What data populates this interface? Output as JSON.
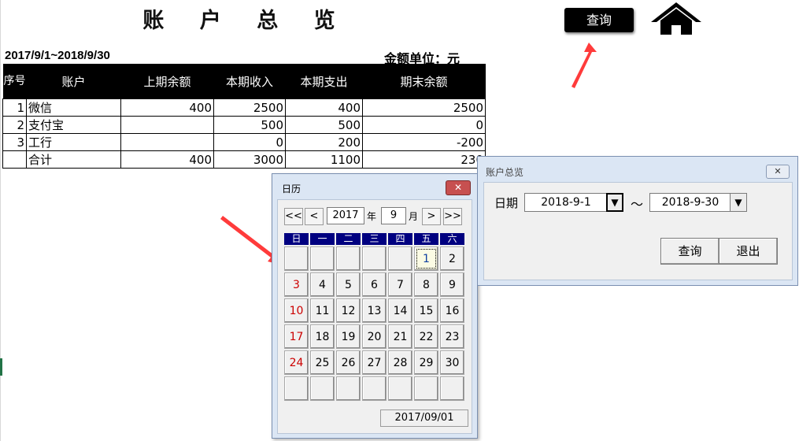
{
  "sheet": {
    "title": "账 户 总 览",
    "period": "2017/9/1~2018/9/30",
    "unit": "金额单位：元",
    "query_button": "查询",
    "home_icon": "home-icon"
  },
  "table": {
    "headers": [
      "序号",
      "账户",
      "上期余额",
      "本期收入",
      "本期支出",
      "期末余额"
    ],
    "rows": [
      {
        "seq": "1",
        "account": "微信",
        "prev": "400",
        "income": "2500",
        "expense": "400",
        "end": "2500"
      },
      {
        "seq": "2",
        "account": "支付宝",
        "prev": "",
        "income": "500",
        "expense": "500",
        "end": "0"
      },
      {
        "seq": "3",
        "account": "工行",
        "prev": "",
        "income": "0",
        "expense": "200",
        "end": "-200"
      },
      {
        "seq": "",
        "account": "合计",
        "prev": "400",
        "income": "3000",
        "expense": "1100",
        "end": "230"
      }
    ]
  },
  "calendar": {
    "caption": "日历",
    "close": "✕",
    "nav": {
      "prev_year": "<<",
      "prev_month": "<",
      "next_month": ">",
      "next_year": ">>"
    },
    "year": "2017",
    "year_label": "年",
    "month": "9",
    "month_label": "月",
    "weekdays": [
      "日",
      "一",
      "二",
      "三",
      "四",
      "五",
      "六"
    ],
    "days": [
      "",
      "",
      "",
      "",
      "",
      "1",
      "2",
      "3",
      "4",
      "5",
      "6",
      "7",
      "8",
      "9",
      "10",
      "11",
      "12",
      "13",
      "14",
      "15",
      "16",
      "17",
      "18",
      "19",
      "20",
      "21",
      "22",
      "23",
      "24",
      "25",
      "26",
      "27",
      "28",
      "29",
      "30",
      "",
      "",
      "",
      "",
      "",
      "",
      ""
    ],
    "selected_day": "1",
    "selected_date": "2017/09/01"
  },
  "dialog": {
    "caption": "账户总览",
    "close": "✕",
    "date_label": "日期",
    "start_date": "2018-9-1",
    "end_date": "2018-9-30",
    "dropdown": "▼",
    "tilde": "～",
    "query": "查询",
    "exit": "退出"
  },
  "colors": {
    "header_bg": "#000000",
    "weekday_bg": "#000080",
    "sunday": "#cc0000",
    "arrow": "#ff3b3b"
  }
}
